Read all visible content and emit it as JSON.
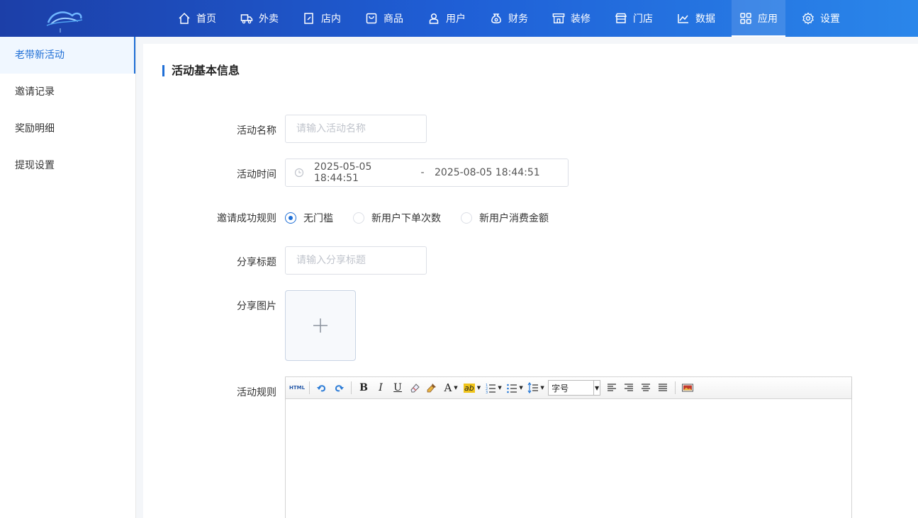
{
  "nav": [
    {
      "label": "首页",
      "icon": "home-icon"
    },
    {
      "label": "外卖",
      "icon": "delivery-icon"
    },
    {
      "label": "店内",
      "icon": "store-edit-icon"
    },
    {
      "label": "商品",
      "icon": "bag-icon"
    },
    {
      "label": "用户",
      "icon": "user-icon"
    },
    {
      "label": "财务",
      "icon": "money-bag-icon"
    },
    {
      "label": "装修",
      "icon": "shop-front-icon"
    },
    {
      "label": "门店",
      "icon": "store-icon"
    },
    {
      "label": "数据",
      "icon": "chart-line-icon"
    },
    {
      "label": "应用",
      "icon": "apps-icon"
    },
    {
      "label": "设置",
      "icon": "gear-icon"
    }
  ],
  "nav_active": "应用",
  "sidebar": {
    "items": [
      {
        "label": "老带新活动"
      },
      {
        "label": "邀请记录"
      },
      {
        "label": "奖励明细"
      },
      {
        "label": "提现设置"
      }
    ]
  },
  "form": {
    "section_title": "活动基本信息",
    "name": {
      "label": "活动名称",
      "placeholder": "请输入活动名称"
    },
    "time": {
      "label": "活动时间",
      "start": "2025-05-05 18:44:51",
      "separator": "-",
      "end": "2025-08-05 18:44:51"
    },
    "rule": {
      "label": "邀请成功规则",
      "options": [
        "无门槛",
        "新用户下单次数",
        "新用户消费金额"
      ],
      "selected": "无门槛"
    },
    "share_title": {
      "label": "分享标题",
      "placeholder": "请输入分享标题"
    },
    "share_image": {
      "label": "分享图片"
    },
    "activity_rule": {
      "label": "活动规则"
    }
  },
  "editor": {
    "html_label": "HTML",
    "font_size_label": "字号"
  },
  "colors": {
    "accent": "#1f6fd6",
    "topbar_start": "#1c3fa8",
    "topbar_end": "#2a86ea"
  }
}
